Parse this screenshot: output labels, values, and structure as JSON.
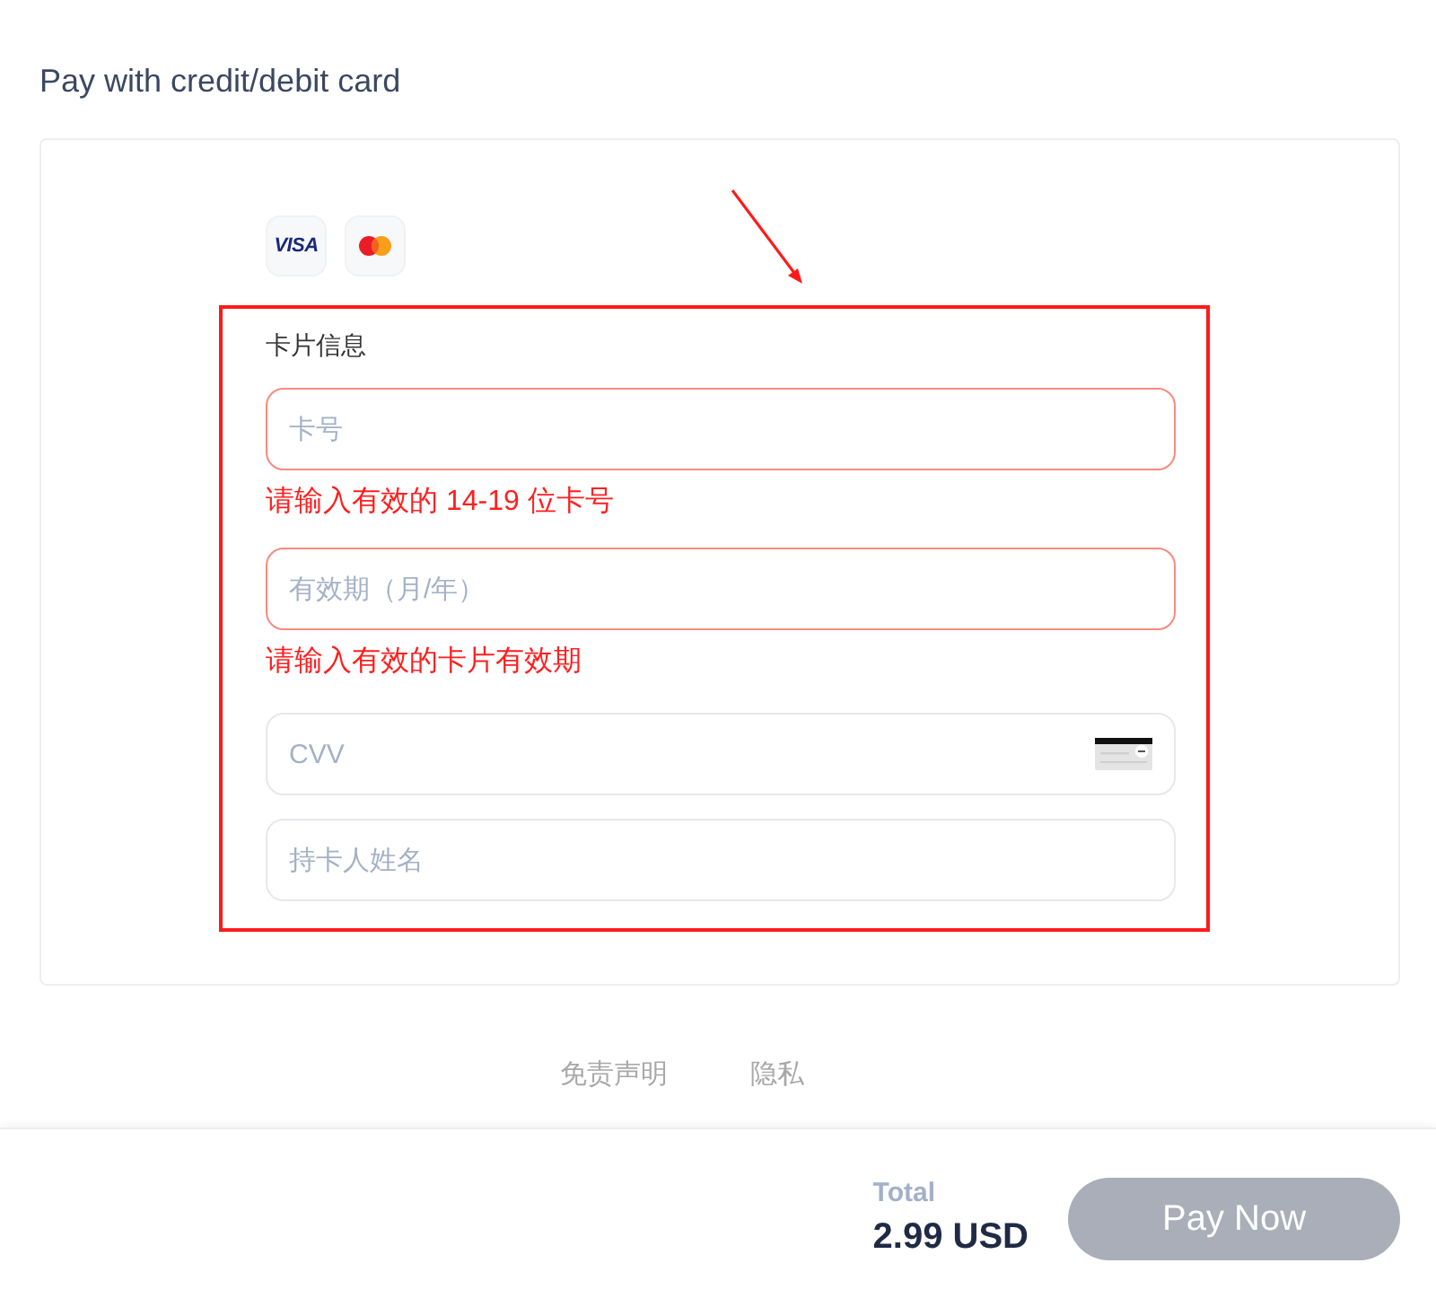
{
  "title": "Pay with credit/debit card",
  "card_brands": [
    {
      "kind": "visa",
      "label": "VISA"
    },
    {
      "kind": "mastercard"
    }
  ],
  "form": {
    "heading": "卡片信息",
    "fields": [
      {
        "kind": "text",
        "placeholder": "卡号",
        "invalid": true,
        "error": "请输入有效的 14-19 位卡号"
      },
      {
        "kind": "text",
        "placeholder": "有效期（月/年）",
        "invalid": true,
        "error": "请输入有效的卡片有效期"
      },
      {
        "kind": "cvv",
        "placeholder": "CVV",
        "invalid": false
      },
      {
        "kind": "text",
        "placeholder": "持卡人姓名",
        "invalid": false
      }
    ]
  },
  "footer_links": [
    "免责声明",
    "隐私"
  ],
  "checkout": {
    "total_label": "Total",
    "total": "2.99 USD",
    "pay_button": {
      "label": "Pay Now",
      "disabled": true
    }
  }
}
